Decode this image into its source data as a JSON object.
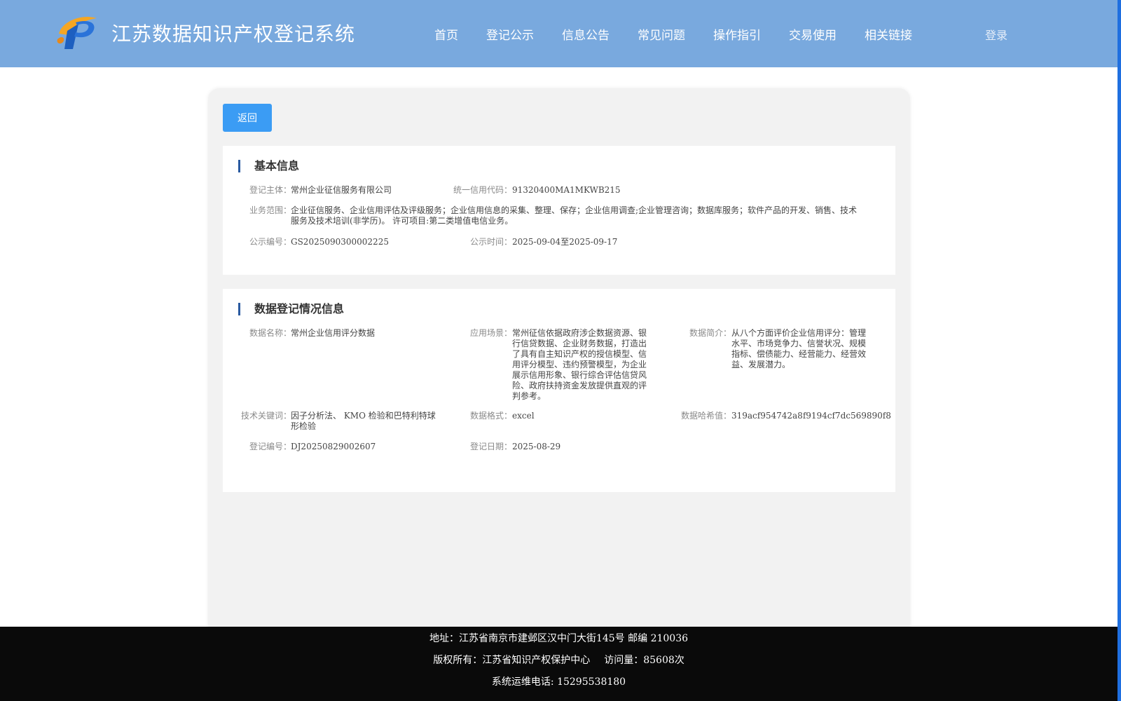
{
  "header": {
    "title": "江苏数据知识产权登记系统",
    "nav": [
      "首页",
      "登记公示",
      "信息公告",
      "常见问题",
      "操作指引",
      "交易使用",
      "相关链接"
    ],
    "login": "登录"
  },
  "back_label": "返回",
  "basic": {
    "title": "基本信息",
    "subject_label": "登记主体：",
    "subject": "常州企业征信服务有限公司",
    "credit_code_label": "统一信用代码：",
    "credit_code": "91320400MA1MKWB215",
    "scope_label": "业务范围：",
    "scope": "企业征信服务、企业信用评估及评级服务；企业信用信息的采集、整理、保存；企业信用调查;企业管理咨询；数据库服务；软件产品的开发、销售、技术服务及技术培训(非学历)。 许可项目:第二类增值电信业务。",
    "pub_no_label": "公示编号：",
    "pub_no": "GS2025090300002225",
    "pub_time_label": "公示时间：",
    "pub_time": "2025-09-04至2025-09-17"
  },
  "reg": {
    "title": "数据登记情况信息",
    "name_label": "数据名称：",
    "name": "常州企业信用评分数据",
    "scene_label": "应用场景：",
    "scene": "常州征信依据政府涉企数据资源、银行信贷数据、企业财务数据，打造出了具有自主知识产权的授信模型、信用评分模型、违约预警模型，为企业展示信用形象、银行综合评估信贷风险、政府扶持资金发放提供直观的评判参考。",
    "intro_label": "数据简介：",
    "intro": "从八个方面评价企业信用评分：管理水平、市场竞争力、信誉状况、规模指标、偿债能力、经营能力、经营效益、发展潜力。",
    "keywords_label": "技术关键词：",
    "keywords": "因子分析法、 KMO 检验和巴特利特球形检验",
    "format_label": "数据格式：",
    "format": "excel",
    "hash_label": "数据哈希值：",
    "hash": "319acf954742a8f9194cf7dc569890f8",
    "reg_no_label": "登记编号：",
    "reg_no": "DJ20250829002607",
    "reg_date_label": "登记日期：",
    "reg_date": "2025-08-29"
  },
  "footer": {
    "address": "地址：江苏省南京市建邺区汉中门大街145号 邮编 210036",
    "copyright": "版权所有：江苏省知识产权保护中心",
    "visits": "访问量：85608次",
    "phone": "系统运维电话: 15295538180"
  },
  "colors": {
    "header_bg": "#79a9de",
    "button_bg": "#3b9cf4",
    "title_bar": "#2a5aa0",
    "footer_bg": "#0a0a0a"
  }
}
